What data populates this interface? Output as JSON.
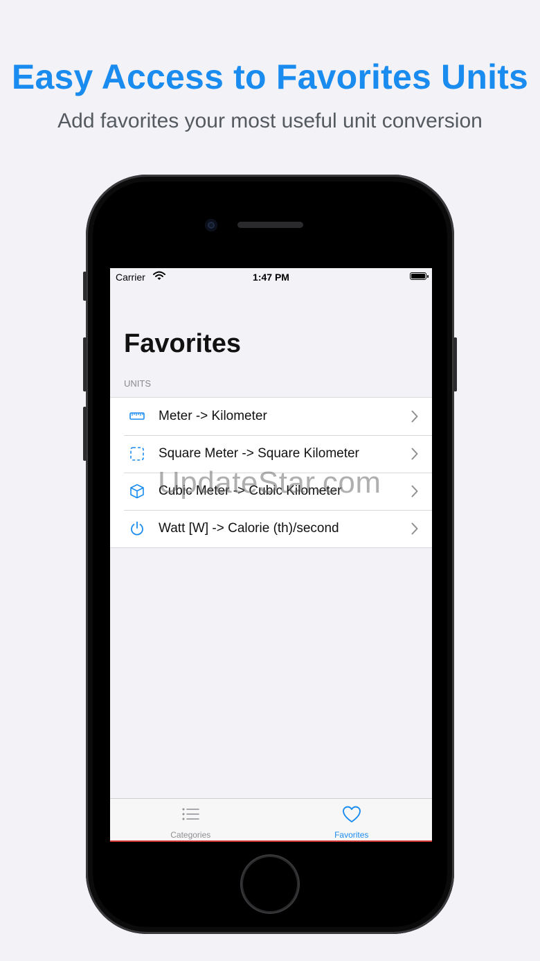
{
  "promo": {
    "headline": "Easy Access to Favorites Units",
    "subheadline": "Add favorites your most useful unit conversion"
  },
  "status_bar": {
    "carrier": "Carrier",
    "time": "1:47 PM"
  },
  "screen": {
    "title": "Favorites",
    "section_header": "UNITS",
    "items": [
      {
        "label": "Meter -> Kilometer",
        "icon": "ruler-icon"
      },
      {
        "label": "Square Meter -> Square Kilometer",
        "icon": "dashed-square-icon"
      },
      {
        "label": "Cubic Meter -> Cubic Kilometer",
        "icon": "cube-icon"
      },
      {
        "label": "Watt [W] -> Calorie (th)/second",
        "icon": "power-icon"
      }
    ]
  },
  "tab_bar": {
    "tabs": [
      {
        "label": "Categories",
        "icon": "list-icon",
        "selected": false
      },
      {
        "label": "Favorites",
        "icon": "heart-icon",
        "selected": true
      }
    ]
  },
  "watermark": "UpdateStar.com",
  "colors": {
    "accent": "#1a8cf0",
    "tab_inactive": "#8e8e93",
    "background": "#f2f2f7"
  }
}
